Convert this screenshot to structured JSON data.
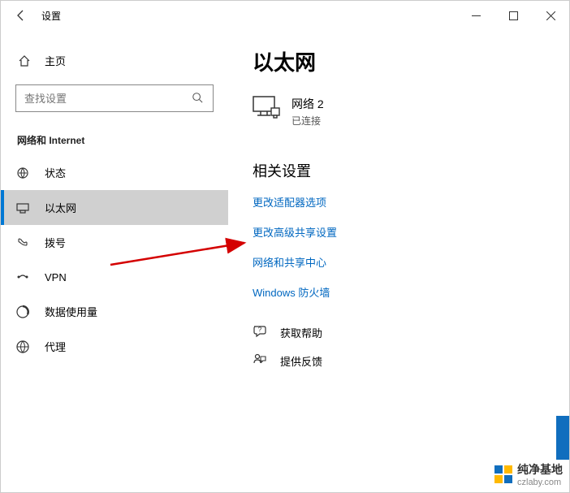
{
  "window": {
    "title": "设置"
  },
  "sidebar": {
    "home_label": "主页",
    "search_placeholder": "查找设置",
    "section_header": "网络和 Internet",
    "items": [
      {
        "label": "状态",
        "icon": "status"
      },
      {
        "label": "以太网",
        "icon": "ethernet"
      },
      {
        "label": "拨号",
        "icon": "dialup"
      },
      {
        "label": "VPN",
        "icon": "vpn"
      },
      {
        "label": "数据使用量",
        "icon": "data-usage"
      },
      {
        "label": "代理",
        "icon": "proxy"
      }
    ]
  },
  "main": {
    "page_title": "以太网",
    "network": {
      "name": "网络 2",
      "status": "已连接"
    },
    "related_header": "相关设置",
    "links": [
      "更改适配器选项",
      "更改高级共享设置",
      "网络和共享中心",
      "Windows 防火墙"
    ],
    "support": {
      "help": "获取帮助",
      "feedback": "提供反馈"
    }
  },
  "watermark": {
    "text": "纯净基地",
    "url": "czlaby.com"
  }
}
